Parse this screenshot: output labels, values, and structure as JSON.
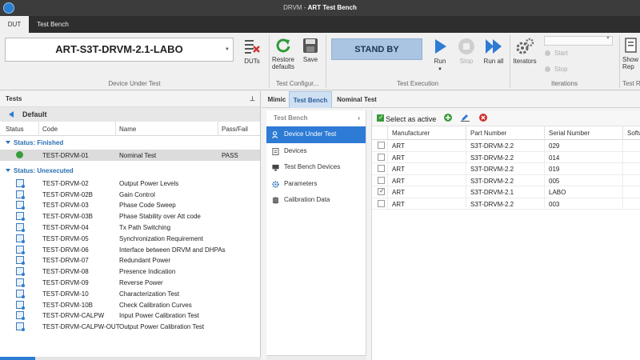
{
  "window": {
    "app": "DRVM",
    "separator": " - ",
    "title": "ART Test Bench"
  },
  "ribbon_tabs": [
    {
      "label": "DUT",
      "active": true
    },
    {
      "label": "Test Bench",
      "active": false
    }
  ],
  "ribbon": {
    "dut_select": "ART-S3T-DRVM-2.1-LABO",
    "dut_button": "DUTs",
    "restore_label_1": "Restore",
    "restore_label_2": "defaults",
    "save_label": "Save",
    "status": "STAND BY",
    "run_label": "Run",
    "stop_label": "Stop",
    "run_all_label": "Run all",
    "iterators_label": "Iterators",
    "iter_start": "Start",
    "iter_stop": "Stop",
    "show_label_1": "Show",
    "show_label_2": "Rep",
    "groups": {
      "device_under_test": "Device Under Test",
      "test_config": "Test Configur...",
      "test_execution": "Test Execution",
      "iterations": "Iterations",
      "test_r": "Test R"
    }
  },
  "tests_panel": {
    "title": "Tests",
    "root": "Default",
    "columns": {
      "status": "Status",
      "code": "Code",
      "name": "Name",
      "result": "Pass/Fail"
    },
    "groups": [
      {
        "label": "Status: Finished",
        "rows": [
          {
            "code": "TEST-DRVM-01",
            "name": "Nominal Test",
            "result": "PASS"
          }
        ]
      },
      {
        "label": "Status: Unexecuted",
        "rows": [
          {
            "code": "TEST-DRVM-02",
            "name": "Output Power Levels"
          },
          {
            "code": "TEST-DRVM-02B",
            "name": "Gain Control"
          },
          {
            "code": "TEST-DRVM-03",
            "name": "Phase Code Sweep"
          },
          {
            "code": "TEST-DRVM-03B",
            "name": "Phase Stability over Att code"
          },
          {
            "code": "TEST-DRVM-04",
            "name": "Tx Path Switching"
          },
          {
            "code": "TEST-DRVM-05",
            "name": "Synchronization Requirement"
          },
          {
            "code": "TEST-DRVM-06",
            "name": "Interface between DRVM and DHPAs"
          },
          {
            "code": "TEST-DRVM-07",
            "name": "Redundant Power"
          },
          {
            "code": "TEST-DRVM-08",
            "name": "Presence Indication"
          },
          {
            "code": "TEST-DRVM-09",
            "name": "Reverse Power"
          },
          {
            "code": "TEST-DRVM-10",
            "name": "Characterization Test"
          },
          {
            "code": "TEST-DRVM-10B",
            "name": "Check Calibration Curves"
          },
          {
            "code": "TEST-DRVM-CALPW",
            "name": "Input Power Calibration Test"
          },
          {
            "code": "TEST-DRVM-CALPW-OUT",
            "name": "Output Power Calibration Test"
          }
        ]
      }
    ]
  },
  "detail_tabs": [
    {
      "label": "Mimic"
    },
    {
      "label": "Test Bench"
    },
    {
      "label": "Nominal Test"
    }
  ],
  "nav": {
    "title": "Test Bench",
    "items": [
      {
        "label": "Device Under Test",
        "icon": "user-search-icon"
      },
      {
        "label": "Devices",
        "icon": "document-icon"
      },
      {
        "label": "Test Bench Devices",
        "icon": "monitor-icon"
      },
      {
        "label": "Parameters",
        "icon": "gear-icon"
      },
      {
        "label": "Calibration Data",
        "icon": "database-icon"
      }
    ]
  },
  "grid": {
    "select_label": "Select as active",
    "columns": {
      "manufacturer": "Manufacturer",
      "part": "Part Number",
      "serial": "Serial Number",
      "software": "Softw"
    },
    "rows": [
      {
        "manufacturer": "ART",
        "part": "S3T-DRVM-2.2",
        "serial": "029",
        "checked": false
      },
      {
        "manufacturer": "ART",
        "part": "S3T-DRVM-2.2",
        "serial": "014",
        "checked": false
      },
      {
        "manufacturer": "ART",
        "part": "S3T-DRVM-2.2",
        "serial": "019",
        "checked": false
      },
      {
        "manufacturer": "ART",
        "part": "S3T-DRVM-2.2",
        "serial": "005",
        "checked": false
      },
      {
        "manufacturer": "ART",
        "part": "S3T-DRVM-2.1",
        "serial": "LABO",
        "checked": true
      },
      {
        "manufacturer": "ART",
        "part": "S3T-DRVM-2.2",
        "serial": "003",
        "checked": false
      }
    ]
  },
  "colors": {
    "accent": "#2e7bd6",
    "pass": "#3a9b3a",
    "delete": "#d03030",
    "standby_bg": "#a9c5e2"
  }
}
